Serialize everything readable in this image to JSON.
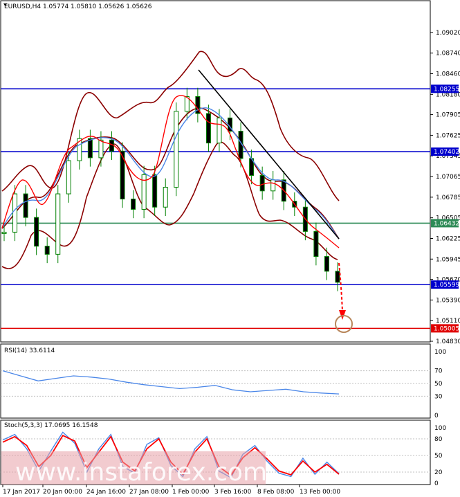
{
  "main": {
    "header": "EURUSD,H4  1.05774 1.05810 1.05626 1.05626",
    "ylim": [
      1.0483,
      1.0931
    ],
    "ticks": [
      "1.09020",
      "1.08740",
      "1.08460",
      "1.08180",
      "1.07905",
      "1.07625",
      "1.07345",
      "1.07065",
      "1.06785",
      "1.06505",
      "1.06225",
      "1.05945",
      "1.05670",
      "1.05390",
      "1.05110",
      "1.04830"
    ],
    "levels": [
      {
        "label": "1.08255",
        "value": 1.08255,
        "color": "#0000cc"
      },
      {
        "label": "1.07402",
        "value": 1.07402,
        "color": "#0000cc"
      },
      {
        "label": "1.06432",
        "value": 1.06432,
        "color": "#2e8b57"
      },
      {
        "label": "1.05599",
        "value": 1.05599,
        "color": "#0000cc"
      },
      {
        "label": "1.05005",
        "value": 1.05005,
        "color": "#e00000"
      }
    ]
  },
  "rsi": {
    "header": "RSI(14) 33.6114",
    "ticks": [
      "100",
      "70",
      "50",
      "30",
      "0"
    ],
    "levels": [
      70,
      50,
      30
    ]
  },
  "stoch": {
    "header": "Stoch(5,3,3) 17.0695 16.1548",
    "ticks": [
      "100",
      "80",
      "50",
      "20",
      "0"
    ],
    "levels": [
      80,
      50,
      20
    ]
  },
  "xaxis": [
    "17 Jan 2017",
    "20 Jan 00:00",
    "24 Jan 16:00",
    "27 Jan 08:00",
    "1 Feb 00:00",
    "3 Feb 16:00",
    "8 Feb 08:00",
    "13 Feb 00:00"
  ],
  "watermark": "www.instaforex.com",
  "colors": {
    "candle": "#008000",
    "bollinger": "#8b0000",
    "ma_fast": "#ff0000",
    "ma_slow": "#4a86e8",
    "trendline": "#000000",
    "arrow": "#ff0000",
    "target_circle": "#b8865a"
  },
  "chart_data": [
    {
      "type": "candlestick",
      "title": "EURUSD,H4",
      "values_printed": {
        "open": 1.05774,
        "high": 1.0581,
        "low": 1.05626,
        "close": 1.05626
      },
      "ylim": [
        1.0483,
        1.0931
      ],
      "series": [
        {
          "name": "",
          "values": [
            1.0631,
            1.0683,
            1.0651,
            1.0612,
            1.0601,
            1.0683,
            1.0728,
            1.0758,
            1.0732,
            1.0756,
            1.0741,
            1.0676,
            1.0662,
            1.0709,
            1.0665,
            1.0692,
            1.0795,
            1.0815,
            1.0792,
            1.0752,
            1.0786,
            1.0768,
            1.0731,
            1.0708,
            1.0687,
            1.0702,
            1.0673,
            1.0665,
            1.0632,
            1.0598,
            1.0578,
            1.0563
          ]
        }
      ]
    },
    {
      "type": "line",
      "title": "RSI(14)",
      "ylim": [
        0,
        100
      ],
      "series": [
        {
          "name": "",
          "values": [
            70,
            62,
            54,
            58,
            62,
            60,
            57,
            52,
            48,
            45,
            42,
            44,
            47,
            40,
            37,
            39,
            41,
            37,
            35,
            33.6
          ]
        }
      ]
    },
    {
      "type": "line",
      "title": "Stoch(5,3,3)",
      "ylim": [
        0,
        100
      ],
      "series": [
        {
          "name": "",
          "values": [
            78,
            88,
            62,
            22,
            58,
            92,
            72,
            20,
            62,
            88,
            30,
            18,
            70,
            82,
            32,
            12,
            62,
            84,
            22,
            10,
            52,
            68,
            40,
            18,
            12,
            45,
            16,
            38,
            17.07
          ]
        },
        {
          "name": "",
          "values": [
            74,
            84,
            68,
            30,
            50,
            86,
            76,
            28,
            56,
            84,
            38,
            22,
            62,
            80,
            38,
            16,
            56,
            80,
            30,
            14,
            46,
            64,
            44,
            22,
            15,
            40,
            20,
            34,
            16.15
          ]
        }
      ]
    }
  ]
}
